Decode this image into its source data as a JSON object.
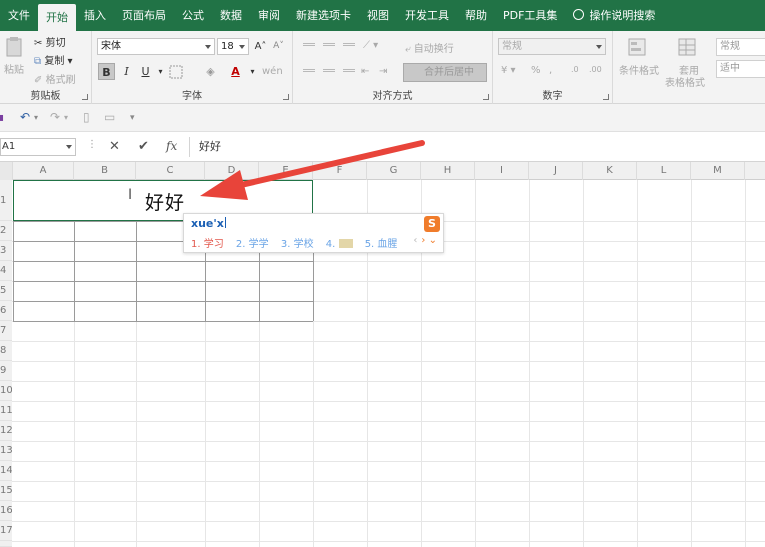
{
  "menu": {
    "tabs": [
      "文件",
      "开始",
      "插入",
      "页面布局",
      "公式",
      "数据",
      "审阅",
      "新建选项卡",
      "视图",
      "开发工具",
      "帮助",
      "PDF工具集"
    ],
    "active_index": 1,
    "tell_me": "操作说明搜索"
  },
  "ribbon": {
    "clipboard": {
      "paste": "粘贴",
      "cut": "剪切",
      "copy": "复制",
      "format_painter": "格式刷",
      "label": "剪贴板"
    },
    "font": {
      "font_name": "宋体",
      "font_size": "18",
      "bold": "B",
      "italic": "I",
      "underline": "U",
      "label": "字体"
    },
    "alignment": {
      "wrap": "自动换行",
      "merge": "合并后居中",
      "label": "对齐方式"
    },
    "number": {
      "format": "常规",
      "percent": "%",
      "label": "数字"
    },
    "styles": {
      "conditional": "条件格式",
      "table": "套用",
      "table2": "表格格式",
      "style_normal": "常规",
      "style_neutral": "适中"
    }
  },
  "formula_bar": {
    "name_box": "A1",
    "cancel": "✕",
    "confirm": "✔",
    "fx": "fx",
    "content": "好好"
  },
  "grid": {
    "columns": [
      "A",
      "B",
      "C",
      "D",
      "E",
      "F",
      "G",
      "H",
      "I",
      "J",
      "K",
      "L",
      "M"
    ],
    "rows": [
      "1",
      "2",
      "3",
      "4",
      "5",
      "6",
      "7",
      "8",
      "9",
      "10",
      "11",
      "12",
      "13",
      "14",
      "15",
      "16",
      "17",
      "18"
    ],
    "cell_a1": "好好"
  },
  "ime": {
    "input": "xue'x",
    "candidates": [
      "1. 学习",
      "2. 学学",
      "3. 学校",
      "4. ",
      "5. 血腥"
    ],
    "logo": "S"
  },
  "colors": {
    "accent": "#217346",
    "arrow": "#e8443a"
  }
}
